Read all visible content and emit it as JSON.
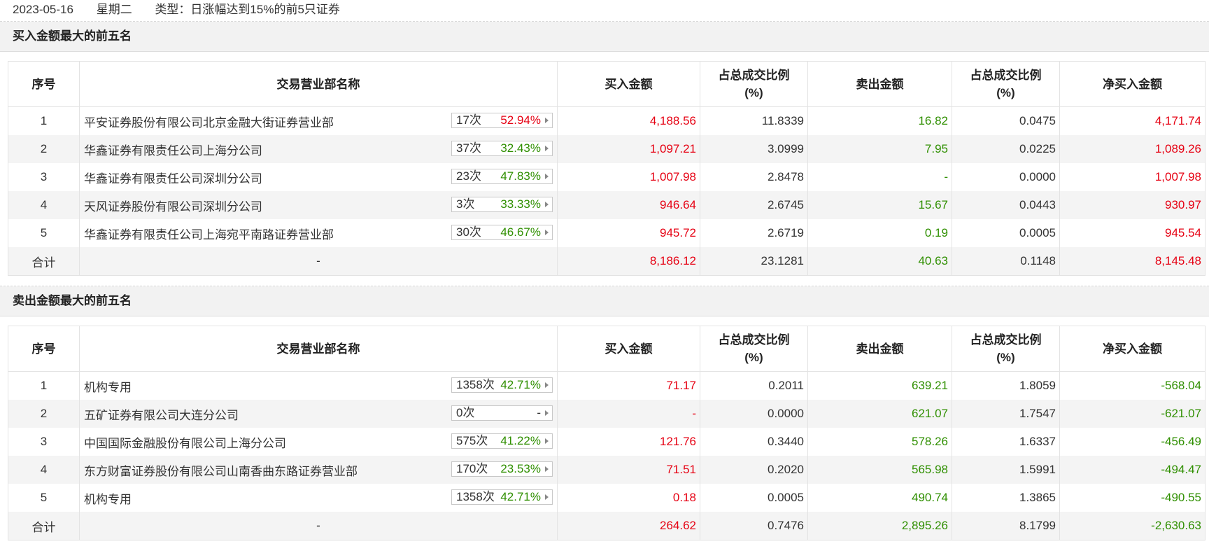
{
  "header": {
    "date": "2023-05-16",
    "weekday": "星期二",
    "type_text": "类型：日涨幅达到15%的前5只证券"
  },
  "columns": {
    "idx": "序号",
    "name": "交易营业部名称",
    "buy": "买入金额",
    "buy_ratio_l1": "占总成交比例",
    "buy_ratio_l2": "(%)",
    "sell": "卖出金额",
    "sell_ratio_l1": "占总成交比例",
    "sell_ratio_l2": "(%)",
    "net": "净买入金额"
  },
  "buy_section": {
    "title": "买入金额最大的前五名",
    "rows": [
      {
        "idx": "1",
        "name": "平安证券股份有限公司北京金融大街证券营业部",
        "count": "17次",
        "pct": "52.94%",
        "pct_color": "red",
        "buy": "4,188.56",
        "buy_ratio": "11.8339",
        "sell": "16.82",
        "sell_ratio": "0.0475",
        "net": "4,171.74",
        "net_color": "red"
      },
      {
        "idx": "2",
        "name": "华鑫证券有限责任公司上海分公司",
        "count": "37次",
        "pct": "32.43%",
        "pct_color": "green",
        "buy": "1,097.21",
        "buy_ratio": "3.0999",
        "sell": "7.95",
        "sell_ratio": "0.0225",
        "net": "1,089.26",
        "net_color": "red"
      },
      {
        "idx": "3",
        "name": "华鑫证券有限责任公司深圳分公司",
        "count": "23次",
        "pct": "47.83%",
        "pct_color": "green",
        "buy": "1,007.98",
        "buy_ratio": "2.8478",
        "sell": "-",
        "sell_ratio": "0.0000",
        "net": "1,007.98",
        "net_color": "red"
      },
      {
        "idx": "4",
        "name": "天风证券股份有限公司深圳分公司",
        "count": "3次",
        "pct": "33.33%",
        "pct_color": "green",
        "buy": "946.64",
        "buy_ratio": "2.6745",
        "sell": "15.67",
        "sell_ratio": "0.0443",
        "net": "930.97",
        "net_color": "red"
      },
      {
        "idx": "5",
        "name": "华鑫证券有限责任公司上海宛平南路证券营业部",
        "count": "30次",
        "pct": "46.67%",
        "pct_color": "green",
        "buy": "945.72",
        "buy_ratio": "2.6719",
        "sell": "0.19",
        "sell_ratio": "0.0005",
        "net": "945.54",
        "net_color": "red"
      }
    ],
    "total": {
      "label": "合计",
      "name": "-",
      "buy": "8,186.12",
      "buy_ratio": "23.1281",
      "sell": "40.63",
      "sell_ratio": "0.1148",
      "net": "8,145.48",
      "net_color": "red"
    }
  },
  "sell_section": {
    "title": "卖出金额最大的前五名",
    "rows": [
      {
        "idx": "1",
        "name": "机构专用",
        "count": "1358次",
        "pct": "42.71%",
        "pct_color": "green",
        "buy": "71.17",
        "buy_ratio": "0.2011",
        "sell": "639.21",
        "sell_ratio": "1.8059",
        "net": "-568.04",
        "net_color": "green"
      },
      {
        "idx": "2",
        "name": "五矿证券有限公司大连分公司",
        "count": "0次",
        "pct": "-",
        "pct_color": "dark",
        "buy": "-",
        "buy_ratio": "0.0000",
        "sell": "621.07",
        "sell_ratio": "1.7547",
        "net": "-621.07",
        "net_color": "green"
      },
      {
        "idx": "3",
        "name": "中国国际金融股份有限公司上海分公司",
        "count": "575次",
        "pct": "41.22%",
        "pct_color": "green",
        "buy": "121.76",
        "buy_ratio": "0.3440",
        "sell": "578.26",
        "sell_ratio": "1.6337",
        "net": "-456.49",
        "net_color": "green"
      },
      {
        "idx": "4",
        "name": "东方财富证券股份有限公司山南香曲东路证券营业部",
        "count": "170次",
        "pct": "23.53%",
        "pct_color": "green",
        "buy": "71.51",
        "buy_ratio": "0.2020",
        "sell": "565.98",
        "sell_ratio": "1.5991",
        "net": "-494.47",
        "net_color": "green"
      },
      {
        "idx": "5",
        "name": "机构专用",
        "count": "1358次",
        "pct": "42.71%",
        "pct_color": "green",
        "buy": "0.18",
        "buy_ratio": "0.0005",
        "sell": "490.74",
        "sell_ratio": "1.3865",
        "net": "-490.55",
        "net_color": "green"
      }
    ],
    "total": {
      "label": "合计",
      "name": "-",
      "buy": "264.62",
      "buy_ratio": "0.7476",
      "sell": "2,895.26",
      "sell_ratio": "8.1799",
      "net": "-2,630.63",
      "net_color": "green"
    }
  },
  "colors": {
    "red": "#e60012",
    "green": "#2f8f00",
    "dark": "#333333"
  },
  "icons": {
    "badge_arrow": "caret-right-icon"
  }
}
